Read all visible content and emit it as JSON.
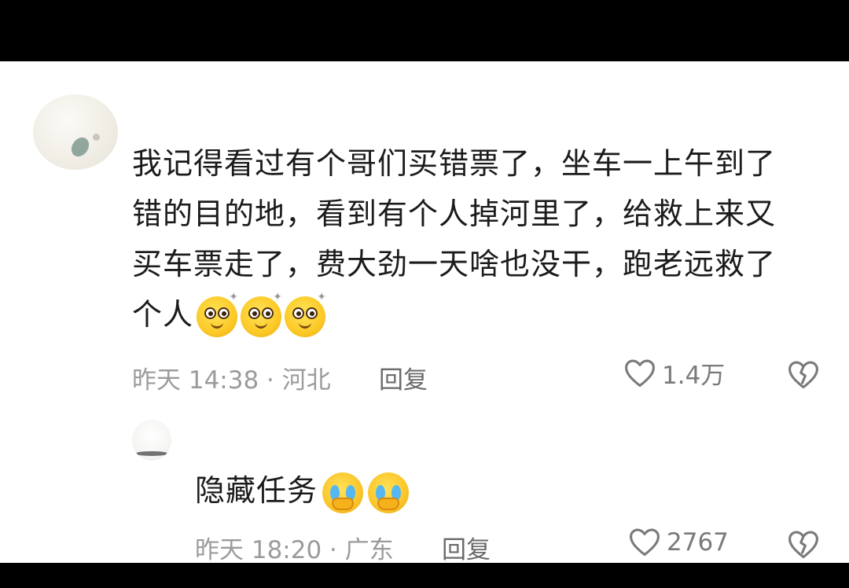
{
  "main_comment": {
    "text_lines": [
      "我记得看过有个哥们买错票了，坐车一上午到了",
      "错的目的地，看到有个人掉河里了，给救上来又",
      "买车票走了，费大劲一天啥也没干，跑老远救了",
      "个人"
    ],
    "emoji_name": "starry-eyed-smile-emoji",
    "emoji_count": 3,
    "meta": "昨天 14:38 · 河北",
    "reply_label": "回复",
    "like_count": "1.4万",
    "like_icon": "heart-outline-icon",
    "dislike_icon": "broken-heart-icon"
  },
  "reply_comment": {
    "text": "隐藏任务",
    "emoji_name": "crying-face-emoji",
    "emoji_count": 2,
    "meta": "昨天 18:20 · 广东",
    "reply_label": "回复",
    "like_count": "2767",
    "like_icon": "heart-outline-icon",
    "dislike_icon": "broken-heart-icon"
  },
  "colors": {
    "text": "#1b1b1b",
    "meta": "#9b9b9b",
    "icon": "#7a7a7a",
    "background": "#ffffff",
    "frame": "#000000"
  }
}
